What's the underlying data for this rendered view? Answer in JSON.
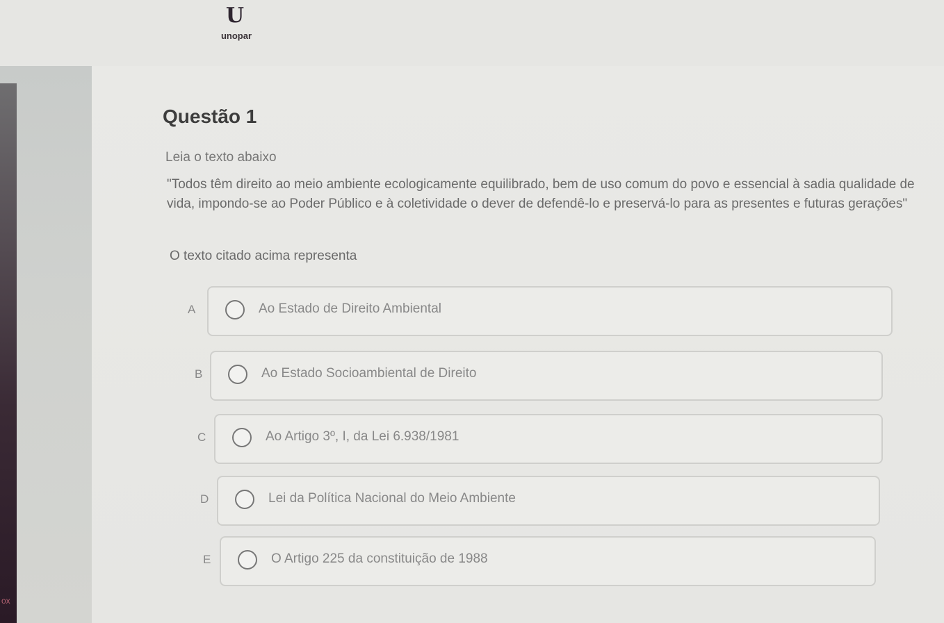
{
  "brand": {
    "logo_mark": "U",
    "name": "unopar"
  },
  "question": {
    "title": "Questão 1",
    "instruction": "Leia o texto abaixo",
    "quote": "\"Todos têm direito ao meio ambiente ecologicamente equilibrado, bem de uso comum do povo e essencial à sadia qualidade de vida, impondo-se ao Poder Público e à coletividade o dever de defendê-lo e preservá-lo para as presentes e futuras gerações\"",
    "prompt": "O texto citado acima representa"
  },
  "options": [
    {
      "letter": "A",
      "text": "Ao Estado de Direito Ambiental"
    },
    {
      "letter": "B",
      "text": "Ao Estado Socioambiental de Direito"
    },
    {
      "letter": "C",
      "text": "Ao Artigo 3º, I, da Lei 6.938/1981"
    },
    {
      "letter": "D",
      "text": "Lei da Política Nacional do Meio Ambiente"
    },
    {
      "letter": "E",
      "text": "O Artigo 225 da constituição de 1988"
    }
  ],
  "corner_label": "ox"
}
